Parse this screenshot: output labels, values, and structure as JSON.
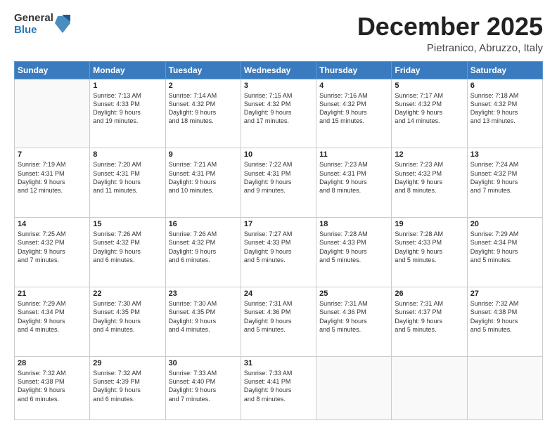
{
  "header": {
    "logo_general": "General",
    "logo_blue": "Blue",
    "month_title": "December 2025",
    "subtitle": "Pietranico, Abruzzo, Italy"
  },
  "days_of_week": [
    "Sunday",
    "Monday",
    "Tuesday",
    "Wednesday",
    "Thursday",
    "Friday",
    "Saturday"
  ],
  "weeks": [
    [
      {
        "day": "",
        "info": ""
      },
      {
        "day": "1",
        "info": "Sunrise: 7:13 AM\nSunset: 4:33 PM\nDaylight: 9 hours\nand 19 minutes."
      },
      {
        "day": "2",
        "info": "Sunrise: 7:14 AM\nSunset: 4:32 PM\nDaylight: 9 hours\nand 18 minutes."
      },
      {
        "day": "3",
        "info": "Sunrise: 7:15 AM\nSunset: 4:32 PM\nDaylight: 9 hours\nand 17 minutes."
      },
      {
        "day": "4",
        "info": "Sunrise: 7:16 AM\nSunset: 4:32 PM\nDaylight: 9 hours\nand 15 minutes."
      },
      {
        "day": "5",
        "info": "Sunrise: 7:17 AM\nSunset: 4:32 PM\nDaylight: 9 hours\nand 14 minutes."
      },
      {
        "day": "6",
        "info": "Sunrise: 7:18 AM\nSunset: 4:32 PM\nDaylight: 9 hours\nand 13 minutes."
      }
    ],
    [
      {
        "day": "7",
        "info": "Sunrise: 7:19 AM\nSunset: 4:31 PM\nDaylight: 9 hours\nand 12 minutes."
      },
      {
        "day": "8",
        "info": "Sunrise: 7:20 AM\nSunset: 4:31 PM\nDaylight: 9 hours\nand 11 minutes."
      },
      {
        "day": "9",
        "info": "Sunrise: 7:21 AM\nSunset: 4:31 PM\nDaylight: 9 hours\nand 10 minutes."
      },
      {
        "day": "10",
        "info": "Sunrise: 7:22 AM\nSunset: 4:31 PM\nDaylight: 9 hours\nand 9 minutes."
      },
      {
        "day": "11",
        "info": "Sunrise: 7:23 AM\nSunset: 4:31 PM\nDaylight: 9 hours\nand 8 minutes."
      },
      {
        "day": "12",
        "info": "Sunrise: 7:23 AM\nSunset: 4:32 PM\nDaylight: 9 hours\nand 8 minutes."
      },
      {
        "day": "13",
        "info": "Sunrise: 7:24 AM\nSunset: 4:32 PM\nDaylight: 9 hours\nand 7 minutes."
      }
    ],
    [
      {
        "day": "14",
        "info": "Sunrise: 7:25 AM\nSunset: 4:32 PM\nDaylight: 9 hours\nand 7 minutes."
      },
      {
        "day": "15",
        "info": "Sunrise: 7:26 AM\nSunset: 4:32 PM\nDaylight: 9 hours\nand 6 minutes."
      },
      {
        "day": "16",
        "info": "Sunrise: 7:26 AM\nSunset: 4:32 PM\nDaylight: 9 hours\nand 6 minutes."
      },
      {
        "day": "17",
        "info": "Sunrise: 7:27 AM\nSunset: 4:33 PM\nDaylight: 9 hours\nand 5 minutes."
      },
      {
        "day": "18",
        "info": "Sunrise: 7:28 AM\nSunset: 4:33 PM\nDaylight: 9 hours\nand 5 minutes."
      },
      {
        "day": "19",
        "info": "Sunrise: 7:28 AM\nSunset: 4:33 PM\nDaylight: 9 hours\nand 5 minutes."
      },
      {
        "day": "20",
        "info": "Sunrise: 7:29 AM\nSunset: 4:34 PM\nDaylight: 9 hours\nand 5 minutes."
      }
    ],
    [
      {
        "day": "21",
        "info": "Sunrise: 7:29 AM\nSunset: 4:34 PM\nDaylight: 9 hours\nand 4 minutes."
      },
      {
        "day": "22",
        "info": "Sunrise: 7:30 AM\nSunset: 4:35 PM\nDaylight: 9 hours\nand 4 minutes."
      },
      {
        "day": "23",
        "info": "Sunrise: 7:30 AM\nSunset: 4:35 PM\nDaylight: 9 hours\nand 4 minutes."
      },
      {
        "day": "24",
        "info": "Sunrise: 7:31 AM\nSunset: 4:36 PM\nDaylight: 9 hours\nand 5 minutes."
      },
      {
        "day": "25",
        "info": "Sunrise: 7:31 AM\nSunset: 4:36 PM\nDaylight: 9 hours\nand 5 minutes."
      },
      {
        "day": "26",
        "info": "Sunrise: 7:31 AM\nSunset: 4:37 PM\nDaylight: 9 hours\nand 5 minutes."
      },
      {
        "day": "27",
        "info": "Sunrise: 7:32 AM\nSunset: 4:38 PM\nDaylight: 9 hours\nand 5 minutes."
      }
    ],
    [
      {
        "day": "28",
        "info": "Sunrise: 7:32 AM\nSunset: 4:38 PM\nDaylight: 9 hours\nand 6 minutes."
      },
      {
        "day": "29",
        "info": "Sunrise: 7:32 AM\nSunset: 4:39 PM\nDaylight: 9 hours\nand 6 minutes."
      },
      {
        "day": "30",
        "info": "Sunrise: 7:33 AM\nSunset: 4:40 PM\nDaylight: 9 hours\nand 7 minutes."
      },
      {
        "day": "31",
        "info": "Sunrise: 7:33 AM\nSunset: 4:41 PM\nDaylight: 9 hours\nand 8 minutes."
      },
      {
        "day": "",
        "info": ""
      },
      {
        "day": "",
        "info": ""
      },
      {
        "day": "",
        "info": ""
      }
    ]
  ]
}
